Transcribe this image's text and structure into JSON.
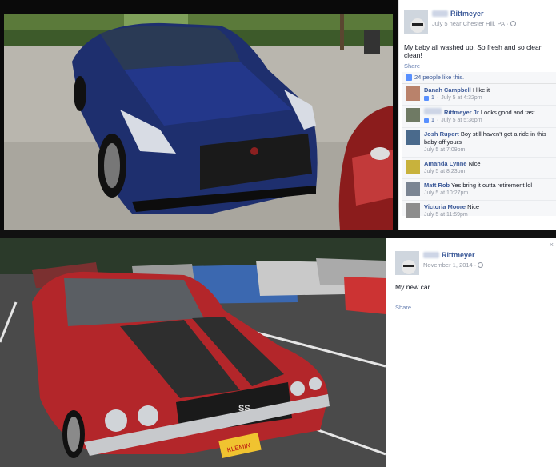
{
  "post_1": {
    "author_last_name": "Rittmeyer",
    "date": "July 5",
    "location": "near Chester Hill, PA",
    "separator": "·",
    "text": "My baby all washed up. So fresh and so clean clean!",
    "share_label": "Share",
    "likes_text": "24 people like this.",
    "comments": [
      {
        "name": "Danah Campbell",
        "text": "I like it",
        "like_count": "1",
        "time": "July 5 at 4:32pm",
        "avatar_color": "#b9826b"
      },
      {
        "name": "Rittmeyer Jr",
        "text": "Looks good and fast",
        "like_count": "1",
        "time": "July 5 at 5:36pm",
        "avatar_color": "#6f7a64"
      },
      {
        "name": "Josh Rupert",
        "text": "Boy still haven't got a ride in this baby off yours",
        "like_count": "",
        "time": "July 5 at 7:09pm",
        "avatar_color": "#4a6a8c"
      },
      {
        "name": "Amanda Lynne",
        "text": "Nice",
        "like_count": "",
        "time": "July 5 at 8:23pm",
        "avatar_color": "#c8b23c"
      },
      {
        "name": "Matt Rob",
        "text": "Yes bring it outta retirement lol",
        "like_count": "",
        "time": "July 5 at 10:27pm",
        "avatar_color": "#7b8593"
      },
      {
        "name": "Victoria Moore",
        "text": "Nice",
        "like_count": "",
        "time": "July 5 at 11:59pm",
        "avatar_color": "#8d8d8d"
      }
    ]
  },
  "post_2": {
    "author_last_name": "Rittmeyer",
    "date": "November 1, 2014",
    "separator": "·",
    "text": "My new car",
    "share_label": "Share",
    "close_label": "×"
  },
  "photo_1": {
    "subject": "blue-sports-car",
    "plate_text": ""
  },
  "photo_2": {
    "subject": "red-muscle-car",
    "badge_text": "SS",
    "plate_text": "KLEMIN"
  }
}
